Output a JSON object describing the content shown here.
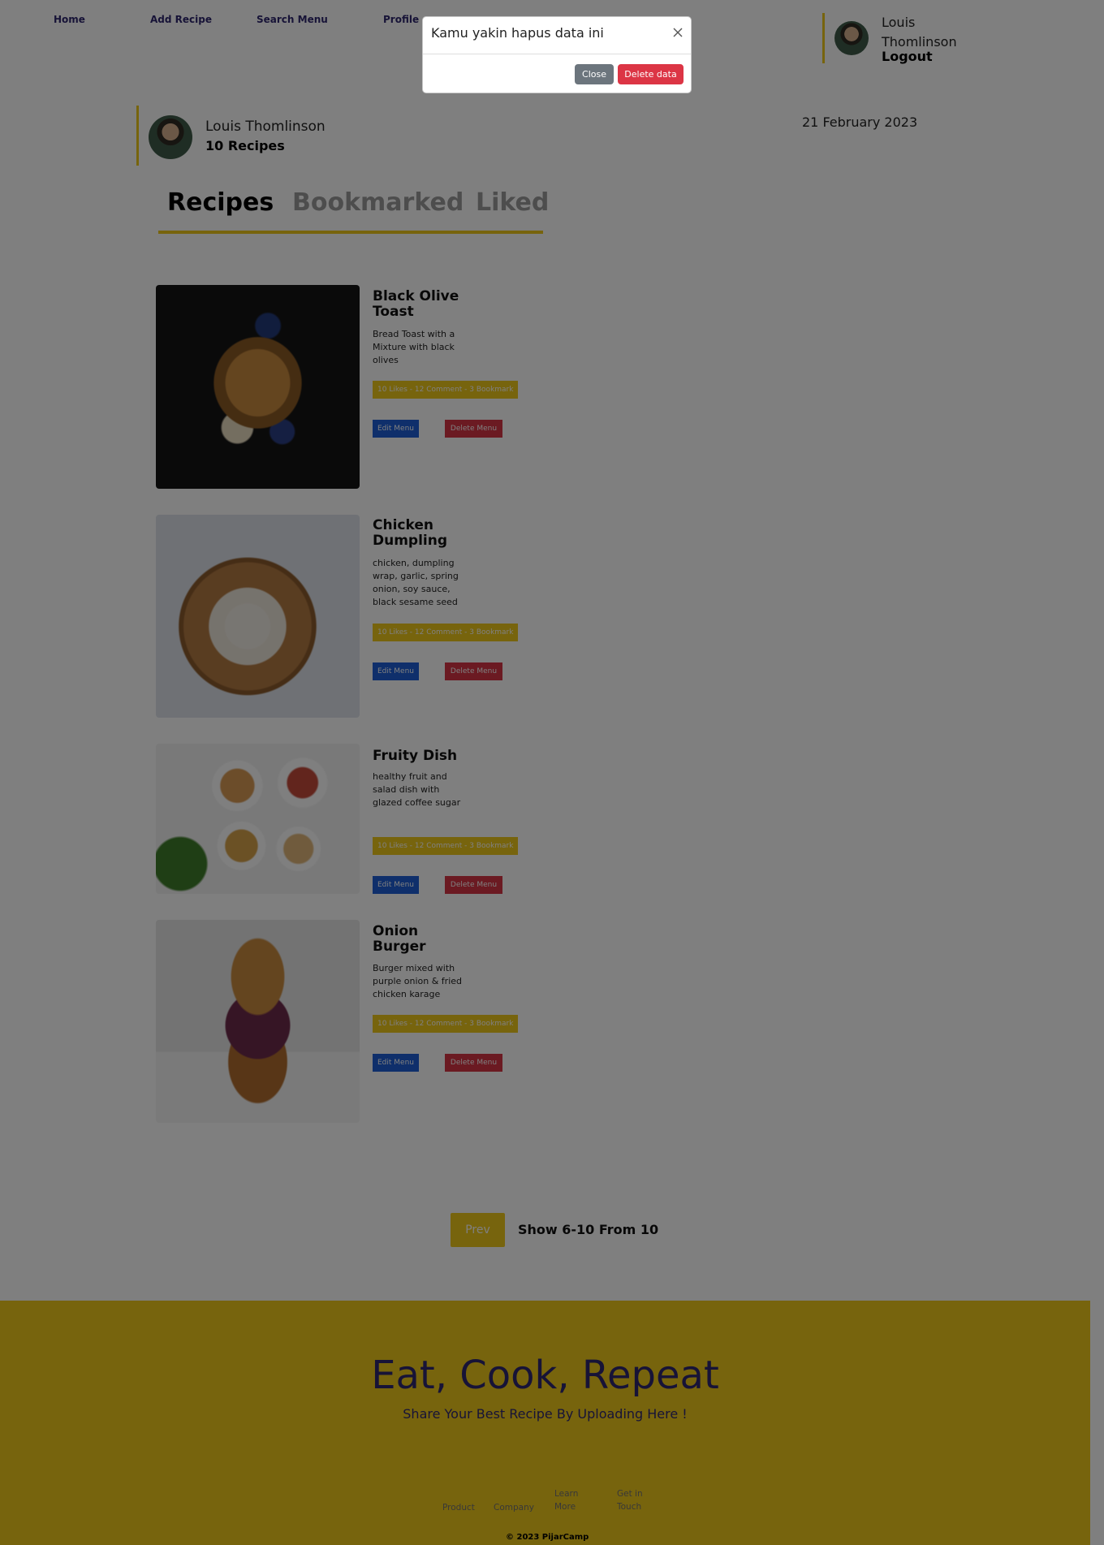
{
  "navbar": {
    "links": [
      "Home",
      "Add Recipe",
      "Search Menu",
      "Profile"
    ],
    "user_name": "Louis Thomlinson",
    "logout_label": "Logout"
  },
  "profile": {
    "name": "Louis Thomlinson",
    "recipe_count": "10 Recipes",
    "date": "21 February 2023"
  },
  "tabs": [
    "Recipes",
    "Bookmarked",
    "Liked"
  ],
  "recipes": [
    {
      "title": "Black Olive Toast",
      "description": "Bread Toast with a Mixture with black olives",
      "stats": "10 Likes - 12 Comment - 3 Bookmark",
      "edit_label": "Edit Menu",
      "delete_label": "Delete Menu"
    },
    {
      "title": "Chicken Dumpling",
      "description": "chicken, dumpling wrap, garlic, spring onion, soy sauce, black sesame seed",
      "stats": "10 Likes - 12 Comment - 3 Bookmark",
      "edit_label": "Edit Menu",
      "delete_label": "Delete Menu"
    },
    {
      "title": "Fruity Dish",
      "description": "healthy fruit and salad dish with glazed coffee sugar",
      "stats": "10 Likes - 12 Comment - 3 Bookmark",
      "edit_label": "Edit Menu",
      "delete_label": "Delete Menu"
    },
    {
      "title": "Onion Burger",
      "description": "Burger mixed with purple onion & fried chicken karage",
      "stats": "10 Likes - 12 Comment - 3 Bookmark",
      "edit_label": "Edit Menu",
      "delete_label": "Delete Menu"
    }
  ],
  "pagination": {
    "prev_label": "Prev",
    "info": "Show 6-10 From 10"
  },
  "footer": {
    "heading": "Eat, Cook, Repeat",
    "subheading": "Share Your Best Recipe By Uploading Here !",
    "links": [
      "Product",
      "Company",
      "Learn More",
      "Get in Touch"
    ],
    "copyright": "© 2023 PijarCamp"
  },
  "modal": {
    "title": "Kamu yakin hapus data ini",
    "close_label": "Close",
    "delete_label": "Delete data"
  },
  "colors": {
    "accent": "#efc81a",
    "brand_text": "#2e266f",
    "edit_button": "#1f5fd6",
    "delete_button": "#d63545",
    "overlay": "rgba(0,0,0,0.5)"
  },
  "icons": {
    "modal_close": "close-icon"
  }
}
